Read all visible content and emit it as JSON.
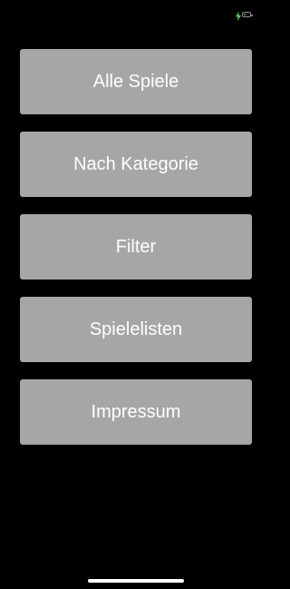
{
  "status_bar": {
    "battery_level": 0.4,
    "charging": true,
    "charge_color": "#4cd964",
    "battery_icon": "battery-icon",
    "charge_icon": "bolt-icon"
  },
  "menu": {
    "button_color": "#a6a6a6",
    "items": [
      {
        "label": "Alle Spiele"
      },
      {
        "label": "Nach Kategorie"
      },
      {
        "label": "Filter"
      },
      {
        "label": "Spielelisten"
      },
      {
        "label": "Impressum"
      }
    ]
  }
}
